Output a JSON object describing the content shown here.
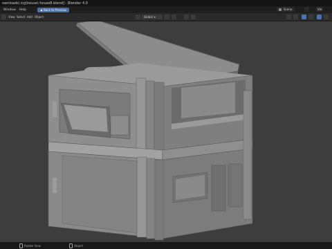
{
  "window": {
    "title": "ownloads\\ icg\\house\\ house8.blend] - Blender 4.0"
  },
  "menubar": {
    "items": [
      "Window",
      "Help"
    ],
    "back_button": "Back to Previous",
    "scene_label": "Scene",
    "view_layer_label": "Vie"
  },
  "header": {
    "items": [
      "View",
      "Select",
      "Add",
      "Object"
    ],
    "transform_orientation": "Global",
    "accent": "#4a72b4"
  },
  "statusbar": {
    "rotate_label": "Rotate View",
    "object_label": "Object"
  }
}
